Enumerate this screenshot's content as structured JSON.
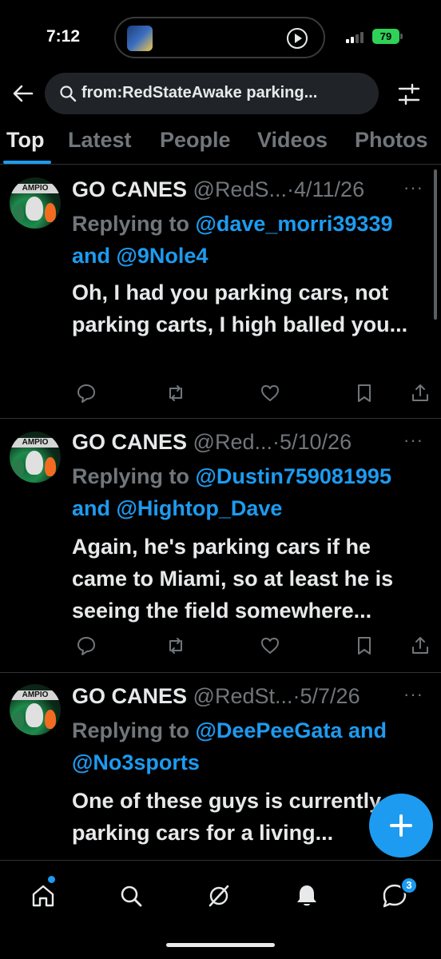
{
  "status": {
    "time": "7:12",
    "battery": "79"
  },
  "search": {
    "query": "from:RedStateAwake parking..."
  },
  "tabs": [
    {
      "label": "Top"
    },
    {
      "label": "Latest"
    },
    {
      "label": "People"
    },
    {
      "label": "Videos"
    },
    {
      "label": "Photos"
    }
  ],
  "avatar_text": "AMPIO",
  "tweets": [
    {
      "name": "GO CANES",
      "handle": "@RedS...",
      "date": "4/11/26",
      "replying_prefix": "Replying to ",
      "mention1": "@dave_morri39339",
      "joiner": "and",
      "mention2": "@9Nole4",
      "body": "Oh, I had you parking cars, not parking carts, I high balled you..."
    },
    {
      "name": "GO CANES",
      "handle": "@Red...",
      "date": "5/10/26",
      "replying_prefix": "Replying to ",
      "mention1": "@Dustin759081995",
      "joiner": "and",
      "mention2": "@Hightop_Dave",
      "body": "Again, he's parking cars if he came to Miami, so at least he is seeing the field somewhere..."
    },
    {
      "name": "GO CANES",
      "handle": "@RedSt...",
      "date": "5/7/26",
      "replying_prefix": "Replying to ",
      "mention1": "@DeePeeGata",
      "joiner": "and",
      "mention2": "@No3sports",
      "body": "One of these guys is currently parking cars for a living..."
    }
  ],
  "nav": {
    "messages_badge": "3"
  },
  "colors": {
    "accent": "#1d9bf0",
    "background": "#000000",
    "muted": "#71767b",
    "text": "#e7e9ea"
  }
}
